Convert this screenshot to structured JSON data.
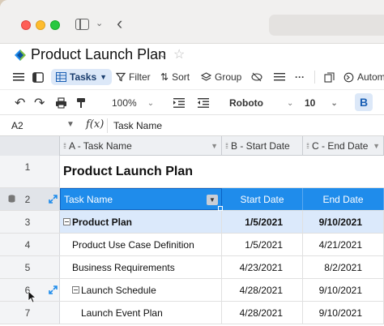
{
  "app": {
    "sheet_title": "Product Launch Plan"
  },
  "toolbar": {
    "view_label": "Tasks",
    "filter_label": "Filter",
    "sort_label": "Sort",
    "group_label": "Group",
    "automate_label": "Autom"
  },
  "format_bar": {
    "zoom": "100%",
    "font": "Roboto",
    "font_size": "10",
    "bold_label": "B"
  },
  "formula_bar": {
    "cell_ref": "A2",
    "fx_label": "f(x)",
    "value": "Task Name"
  },
  "columns": [
    {
      "label": "A - Task Name"
    },
    {
      "label": "B - Start Date"
    },
    {
      "label": "C - End Date"
    }
  ],
  "rows": [
    {
      "num": "1",
      "a": "Product Launch Plan",
      "b": "",
      "c": ""
    },
    {
      "num": "2",
      "a": "Task Name",
      "b": "Start Date",
      "c": "End Date"
    },
    {
      "num": "3",
      "a": "Product Plan",
      "b": "1/5/2021",
      "c": "9/10/2021"
    },
    {
      "num": "4",
      "a": "Product Use Case Definition",
      "b": "1/5/2021",
      "c": "4/21/2021"
    },
    {
      "num": "5",
      "a": "Business Requirements",
      "b": "4/23/2021",
      "c": "8/2/2021"
    },
    {
      "num": "6",
      "a": "Launch Schedule",
      "b": "4/28/2021",
      "c": "9/10/2021"
    },
    {
      "num": "7",
      "a": "Launch Event Plan",
      "b": "4/28/2021",
      "c": "9/10/2021"
    }
  ],
  "colors": {
    "header_fill": "#1f8ceb",
    "highlight_row": "#dbe9fb",
    "accent": "#1a5fb4"
  }
}
